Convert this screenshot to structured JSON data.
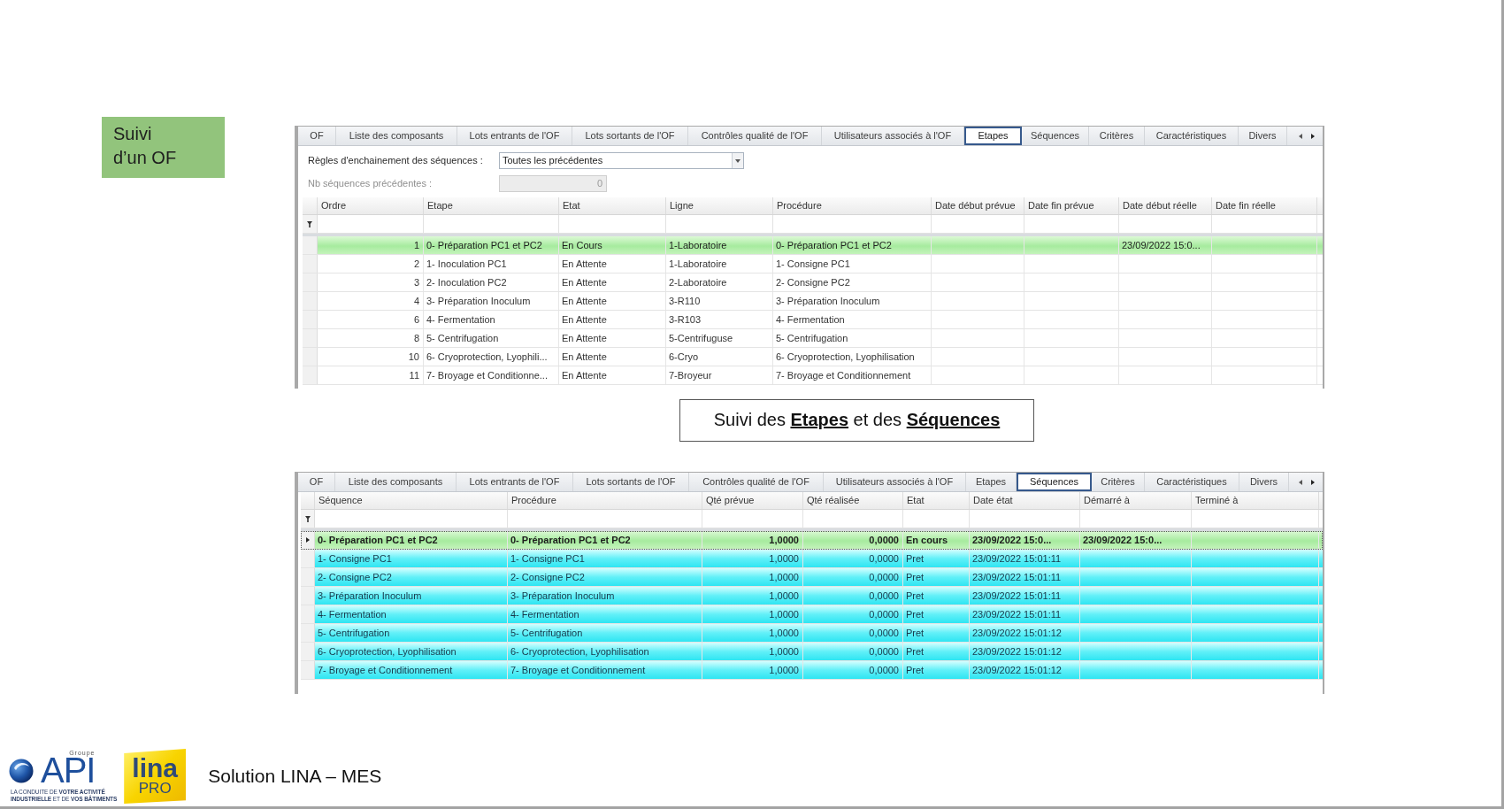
{
  "slide_label": "Suivi d’un OF",
  "etapes_panel": {
    "tabs": [
      {
        "label": "OF",
        "selected": false
      },
      {
        "label": "Liste des composants",
        "selected": false
      },
      {
        "label": "Lots entrants de l'OF",
        "selected": false
      },
      {
        "label": "Lots sortants de l'OF",
        "selected": false
      },
      {
        "label": "Contrôles qualité de l'OF",
        "selected": false
      },
      {
        "label": "Utilisateurs associés à l'OF",
        "selected": false
      },
      {
        "label": "Etapes",
        "selected": true
      },
      {
        "label": "Séquences",
        "selected": false
      },
      {
        "label": "Critères",
        "selected": false
      },
      {
        "label": "Caractéristiques",
        "selected": false
      },
      {
        "label": "Divers",
        "selected": false
      }
    ],
    "form": {
      "rules_label": "Règles d'enchainement des séquences :",
      "rules_select": {
        "value": "Toutes les précédentes"
      },
      "count_label": "Nb séquences précédentes :",
      "count_field": {
        "value": "0",
        "disabled": true
      }
    },
    "table": {
      "columns": [
        {
          "label": "Ordre",
          "kind": "number"
        },
        {
          "label": "Etape",
          "kind": "text"
        },
        {
          "label": "Etat",
          "kind": "text"
        },
        {
          "label": "Ligne",
          "kind": "text"
        },
        {
          "label": "Procédure",
          "kind": "text"
        },
        {
          "label": "Date début prévue",
          "kind": "text"
        },
        {
          "label": "Date fin prévue",
          "kind": "text"
        },
        {
          "label": "Date début réelle",
          "kind": "text"
        },
        {
          "label": "Date fin réelle",
          "kind": "text"
        }
      ],
      "rows": [
        {
          "kind": "current",
          "cells": [
            "1",
            "0- Préparation PC1 et PC2",
            "En Cours",
            "1-Laboratoire",
            "0- Préparation PC1 et PC2",
            null,
            null,
            "23/09/2022 15:0...",
            null
          ]
        },
        {
          "kind": "waiting",
          "cells": [
            "2",
            "1- Inoculation PC1",
            "En Attente",
            "1-Laboratoire",
            "1- Consigne PC1",
            null,
            null,
            null,
            null
          ]
        },
        {
          "kind": "waiting",
          "cells": [
            "3",
            "2- Inoculation PC2",
            "En Attente",
            "2-Laboratoire",
            "2- Consigne PC2",
            null,
            null,
            null,
            null
          ]
        },
        {
          "kind": "waiting",
          "cells": [
            "4",
            "3- Préparation Inoculum",
            "En Attente",
            "3-R110",
            "3- Préparation Inoculum",
            null,
            null,
            null,
            null
          ]
        },
        {
          "kind": "waiting",
          "cells": [
            "6",
            "4- Fermentation",
            "En Attente",
            "3-R103",
            "4- Fermentation",
            null,
            null,
            null,
            null
          ]
        },
        {
          "kind": "waiting",
          "cells": [
            "8",
            "5- Centrifugation",
            "En Attente",
            "5-Centrifuguse",
            "5- Centrifugation",
            null,
            null,
            null,
            null
          ]
        },
        {
          "kind": "waiting",
          "cells": [
            "10",
            "6- Cryoprotection, Lyophili...",
            "En Attente",
            "6-Cryo",
            "6- Cryoprotection, Lyophilisation",
            null,
            null,
            null,
            null
          ]
        },
        {
          "kind": "waiting",
          "cells": [
            "11",
            "7- Broyage et Conditionne...",
            "En Attente",
            "7-Broyeur",
            "7- Broyage et Conditionnement",
            null,
            null,
            null,
            null
          ]
        }
      ]
    }
  },
  "caption": "Suivi des **Etapes** et des **Séquences**",
  "sequences_panel": {
    "tabs": [
      {
        "label": "OF",
        "selected": false
      },
      {
        "label": "Liste des composants",
        "selected": false
      },
      {
        "label": "Lots entrants de l'OF",
        "selected": false
      },
      {
        "label": "Lots sortants de l'OF",
        "selected": false
      },
      {
        "label": "Contrôles qualité de l'OF",
        "selected": false
      },
      {
        "label": "Utilisateurs associés à l'OF",
        "selected": false
      },
      {
        "label": "Etapes",
        "selected": false
      },
      {
        "label": "Séquences",
        "selected": true
      },
      {
        "label": "Critères",
        "selected": false
      },
      {
        "label": "Caractéristiques",
        "selected": false
      },
      {
        "label": "Divers",
        "selected": false
      }
    ],
    "table": {
      "columns": [
        {
          "label": "Séquence",
          "kind": "text"
        },
        {
          "label": "Procédure",
          "kind": "text"
        },
        {
          "label": "Qté prévue",
          "kind": "number"
        },
        {
          "label": "Qté réalisée",
          "kind": "number"
        },
        {
          "label": "Etat",
          "kind": "text"
        },
        {
          "label": "Date état",
          "kind": "text"
        },
        {
          "label": "Démarré à",
          "kind": "text"
        },
        {
          "label": "Terminé à",
          "kind": "text"
        }
      ],
      "rows": [
        {
          "kind": "current",
          "selected": true,
          "cells": [
            "0- Préparation PC1 et PC2",
            "0- Préparation PC1 et PC2",
            "1,0000",
            "0,0000",
            "En cours",
            "23/09/2022 15:0...",
            "23/09/2022 15:0...",
            null
          ]
        },
        {
          "kind": "ready",
          "selected": false,
          "cells": [
            "1- Consigne PC1",
            "1- Consigne PC1",
            "1,0000",
            "0,0000",
            "Pret",
            "23/09/2022 15:01:11",
            null,
            null
          ]
        },
        {
          "kind": "ready",
          "selected": false,
          "cells": [
            "2- Consigne PC2",
            "2- Consigne PC2",
            "1,0000",
            "0,0000",
            "Pret",
            "23/09/2022 15:01:11",
            null,
            null
          ]
        },
        {
          "kind": "ready",
          "selected": false,
          "cells": [
            "3- Préparation Inoculum",
            "3- Préparation Inoculum",
            "1,0000",
            "0,0000",
            "Pret",
            "23/09/2022 15:01:11",
            null,
            null
          ]
        },
        {
          "kind": "ready",
          "selected": false,
          "cells": [
            "4- Fermentation",
            "4- Fermentation",
            "1,0000",
            "0,0000",
            "Pret",
            "23/09/2022 15:01:11",
            null,
            null
          ]
        },
        {
          "kind": "ready",
          "selected": false,
          "cells": [
            "5- Centrifugation",
            "5- Centrifugation",
            "1,0000",
            "0,0000",
            "Pret",
            "23/09/2022 15:01:12",
            null,
            null
          ]
        },
        {
          "kind": "ready",
          "selected": false,
          "cells": [
            "6- Cryoprotection, Lyophilisation",
            "6- Cryoprotection, Lyophilisation",
            "1,0000",
            "0,0000",
            "Pret",
            "23/09/2022 15:01:12",
            null,
            null
          ]
        },
        {
          "kind": "ready",
          "selected": false,
          "cells": [
            "7- Broyage et Conditionnement",
            "7- Broyage et Conditionnement",
            "1,0000",
            "0,0000",
            "Pret",
            "23/09/2022 15:01:12",
            null,
            null
          ]
        }
      ]
    }
  },
  "footer": {
    "api_logo": {
      "group": "Groupe",
      "name": "API",
      "tagline": [
        "LA CONDUITE DE **VOTRE ACTIVITÉ**",
        "**INDUSTRIELLE** ET DE **VOS BÂTIMENTS**"
      ]
    },
    "lina_logo": {
      "name": "lina",
      "sub": "PRO"
    },
    "title": "Solution LINA – MES"
  }
}
